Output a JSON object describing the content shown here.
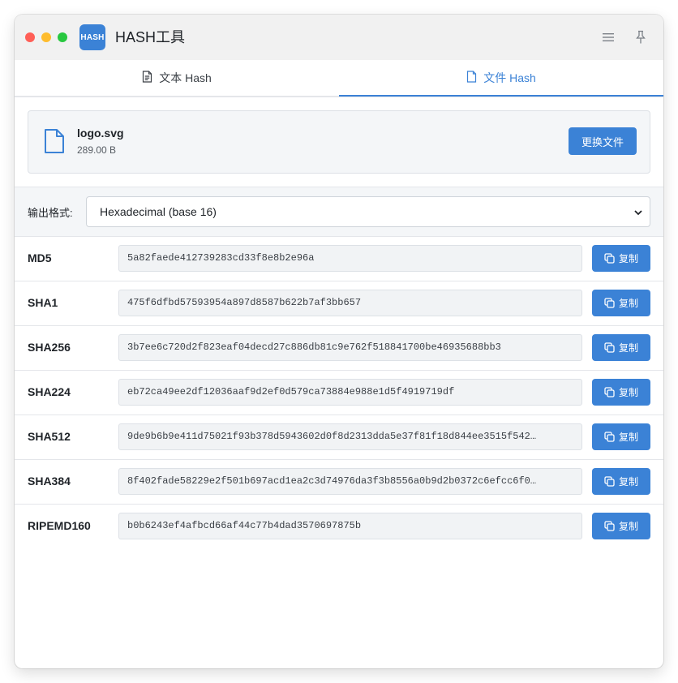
{
  "window": {
    "title": "HASH工具",
    "logo_text": "HASH"
  },
  "tabs": [
    {
      "label": "文本 Hash",
      "active": false
    },
    {
      "label": "文件 Hash",
      "active": true
    }
  ],
  "file": {
    "name": "logo.svg",
    "size": "289.00 B",
    "change_label": "更换文件"
  },
  "format": {
    "label": "输出格式:",
    "selected": "Hexadecimal (base 16)"
  },
  "copy_label": "复制",
  "hashes": [
    {
      "name": "MD5",
      "value": "5a82faede412739283cd33f8e8b2e96a"
    },
    {
      "name": "SHA1",
      "value": "475f6dfbd57593954a897d8587b622b7af3bb657"
    },
    {
      "name": "SHA256",
      "value": "3b7ee6c720d2f823eaf04decd27c886db81c9e762f518841700be46935688bb3"
    },
    {
      "name": "SHA224",
      "value": "eb72ca49ee2df12036aaf9d2ef0d579ca73884e988e1d5f4919719df"
    },
    {
      "name": "SHA512",
      "value": "9de9b6b9e411d75021f93b378d5943602d0f8d2313dda5e37f81f18d844ee3515f542…"
    },
    {
      "name": "SHA384",
      "value": "8f402fade58229e2f501b697acd1ea2c3d74976da3f3b8556a0b9d2b0372c6efcc6f0…"
    },
    {
      "name": "RIPEMD160",
      "value": "b0b6243ef4afbcd66af44c77b4dad3570697875b"
    }
  ],
  "colors": {
    "accent": "#3b82d6",
    "titlebar": "#f1f1f1",
    "close": "#ff5f57",
    "minimize": "#febc2e",
    "zoom": "#28c840"
  },
  "icons": {
    "menu": "menu-icon",
    "pin": "pin-icon",
    "document": "document-icon",
    "file": "file-icon",
    "copy": "copy-icon",
    "chevron": "chevron-down-icon"
  }
}
